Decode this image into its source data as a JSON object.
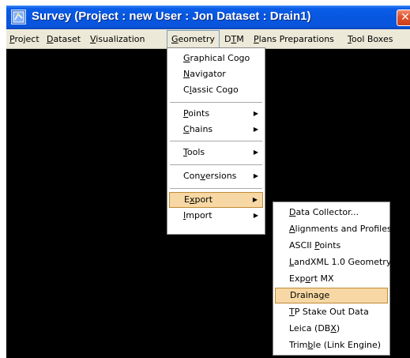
{
  "window": {
    "title": "Survey (Project : new   User : Jon   Dataset : Drain1)",
    "close_glyph": "✕",
    "icon": "survey-app-icon"
  },
  "menubar": {
    "items": [
      {
        "label": "Project",
        "mnemonic": "P"
      },
      {
        "label": "Dataset",
        "mnemonic": "D"
      },
      {
        "label": "Visualization",
        "mnemonic": "V"
      },
      {
        "label": "Geometry",
        "mnemonic": "G",
        "open": true
      },
      {
        "label": "DTM",
        "mnemonic": "T"
      },
      {
        "label": "Plans Preparations",
        "mnemonic": "P"
      },
      {
        "label": "Tool Boxes",
        "mnemonic": "T"
      }
    ]
  },
  "geometry_menu": {
    "items": [
      {
        "label": "Graphical Cogo",
        "mnemonic": "G"
      },
      {
        "label": "Navigator",
        "mnemonic": "N"
      },
      {
        "label": "Classic Cogo",
        "mnemonic": "l"
      },
      {
        "separator": true
      },
      {
        "label": "Points",
        "mnemonic": "P",
        "submenu": true
      },
      {
        "label": "Chains",
        "mnemonic": "C",
        "submenu": true
      },
      {
        "separator": true
      },
      {
        "label": "Tools",
        "mnemonic": "T",
        "submenu": true
      },
      {
        "separator": true
      },
      {
        "label": "Conversions",
        "mnemonic": "v",
        "submenu": true
      },
      {
        "separator": true
      },
      {
        "label": "Export",
        "mnemonic": "x",
        "submenu": true,
        "highlighted": true
      },
      {
        "label": "Import",
        "mnemonic": "I",
        "submenu": true
      }
    ]
  },
  "export_submenu": {
    "items": [
      {
        "label": "Data Collector...",
        "mnemonic": "D"
      },
      {
        "label": "Alignments and Profiles",
        "mnemonic": "A"
      },
      {
        "label": "ASCII Points",
        "mnemonic": "P"
      },
      {
        "label": "LandXML 1.0 Geometry",
        "mnemonic": "L"
      },
      {
        "label": "Export MX",
        "mnemonic": "o"
      },
      {
        "label": "Drainage",
        "mnemonic": "g",
        "highlighted": true
      },
      {
        "label": "TP Stake Out Data",
        "mnemonic": "T"
      },
      {
        "label": "Leica (DBX)",
        "mnemonic": "X"
      },
      {
        "label": "Trimble (Link Engine)",
        "mnemonic": "b"
      }
    ]
  },
  "colors": {
    "titlebar": "#0756e0",
    "menu_highlight": "#f7d8a4",
    "menu_highlight_border": "#c08a36",
    "workspace": "#000000",
    "close_button": "#e2502a"
  }
}
